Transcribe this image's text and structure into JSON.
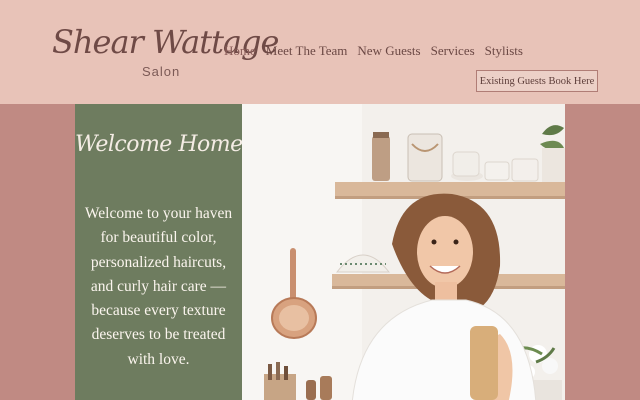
{
  "brand": {
    "name": "Shear Wattage",
    "sub": "Salon"
  },
  "nav": [
    {
      "label": "Home"
    },
    {
      "label": "Meet The Team"
    },
    {
      "label": "New Guests"
    },
    {
      "label": "Services"
    },
    {
      "label": "Stylists"
    }
  ],
  "cta": {
    "label": "Existing Guests Book Here"
  },
  "hero": {
    "title": "Welcome Home",
    "body": "Welcome to your haven for beautiful color, personalized haircuts, and curly hair care — because every texture deserves to be treated with love."
  },
  "colors": {
    "header_bg": "#e8c3b8",
    "page_bg": "#c08a83",
    "panel_bg": "#6e7c5f",
    "text_brown": "#6b4844"
  }
}
